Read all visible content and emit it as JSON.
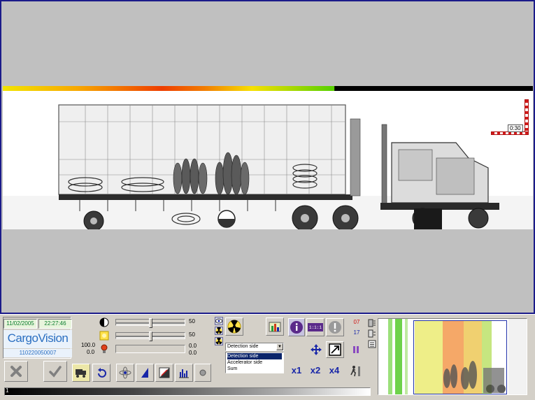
{
  "header": {
    "date": "11/02/2005",
    "time": "22:27:46",
    "brand": "CargoVision",
    "serial": "110220050007"
  },
  "scan": {
    "timer_label": "0:30"
  },
  "image_controls": {
    "contrast_value": "50",
    "brightness_value": "50",
    "dose_max": "100.0",
    "dose_min": "0.0",
    "dose_left_value": "0.0",
    "dose_right_value": "0.0",
    "contrast_level": 0.5,
    "brightness_level": 0.5
  },
  "side_selector": {
    "selected": "Detection side",
    "options": [
      "Detection side",
      "Accelerator side",
      "Sum"
    ]
  },
  "zoom": {
    "x1": "x1",
    "x2": "x2",
    "x4": "x4"
  },
  "info": {
    "display_readout": "1:1:1",
    "counter_top": "07",
    "counter_bottom": "17"
  },
  "bottom": {
    "scale_start": "1"
  },
  "colors": {
    "viewer_border": "#1b1b8a",
    "brand_blue": "#2b6fc1",
    "date_green": "#0a7d2b",
    "zoom_blue": "#1826a8",
    "counter_red": "#d01010"
  }
}
